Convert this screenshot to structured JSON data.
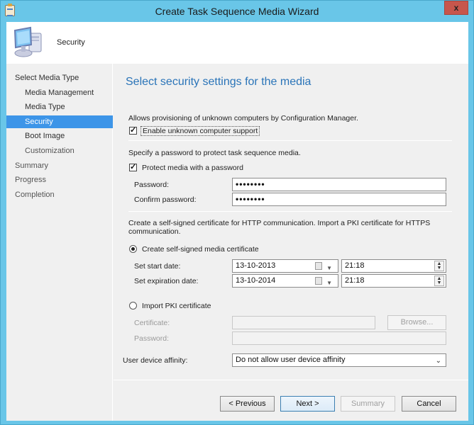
{
  "window": {
    "title": "Create Task Sequence Media Wizard",
    "close_label": "x"
  },
  "header": {
    "page_name": "Security",
    "icon": "computer-icon"
  },
  "nav": {
    "items": [
      {
        "label": "Select Media Type",
        "level": 0,
        "state": "done"
      },
      {
        "label": "Media Management",
        "level": 1,
        "state": "done"
      },
      {
        "label": "Media Type",
        "level": 1,
        "state": "done"
      },
      {
        "label": "Security",
        "level": 1,
        "state": "active"
      },
      {
        "label": "Boot Image",
        "level": 1,
        "state": "pending"
      },
      {
        "label": "Customization",
        "level": 1,
        "state": "pending"
      },
      {
        "label": "Summary",
        "level": 0,
        "state": "pending"
      },
      {
        "label": "Progress",
        "level": 0,
        "state": "pending"
      },
      {
        "label": "Completion",
        "level": 0,
        "state": "pending"
      }
    ]
  },
  "content": {
    "heading": "Select security settings for the media",
    "unknown": {
      "description": "Allows provisioning of unknown computers by Configuration Manager.",
      "checkbox_label": "Enable unknown computer support",
      "checked": true
    },
    "password_section": {
      "description": "Specify a password to protect task sequence media.",
      "checkbox_label": "Protect media with a password",
      "checked": true,
      "password_label": "Password:",
      "password_value": "••••••••",
      "confirm_label": "Confirm password:",
      "confirm_value": "••••••••"
    },
    "certificate": {
      "description_line1": "Create a self-signed certificate for HTTP communication. Import a PKI certificate for HTTPS",
      "description_line2": "communication.",
      "self_signed_label": "Create self-signed media certificate",
      "self_signed_selected": true,
      "start_date_label": "Set start date:",
      "start_date": "13-10-2013",
      "start_time": "21:18",
      "expiration_date_label": "Set expiration date:",
      "expiration_date": "13-10-2014",
      "expiration_time": "21:18",
      "pki_label": "Import PKI certificate",
      "pki_selected": false,
      "certificate_label": "Certificate:",
      "certificate_value": "",
      "browse_label": "Browse...",
      "pki_password_label": "Password:",
      "pki_password_value": ""
    },
    "affinity": {
      "label": "User device affinity:",
      "selected": "Do not allow user device affinity"
    }
  },
  "buttons": {
    "previous": "< Previous",
    "next": "Next >",
    "summary": "Summary",
    "cancel": "Cancel"
  },
  "colors": {
    "frame": "#69c6e8",
    "heading": "#2a74b8",
    "nav_active": "#3d95e8",
    "close": "#c7564c"
  }
}
